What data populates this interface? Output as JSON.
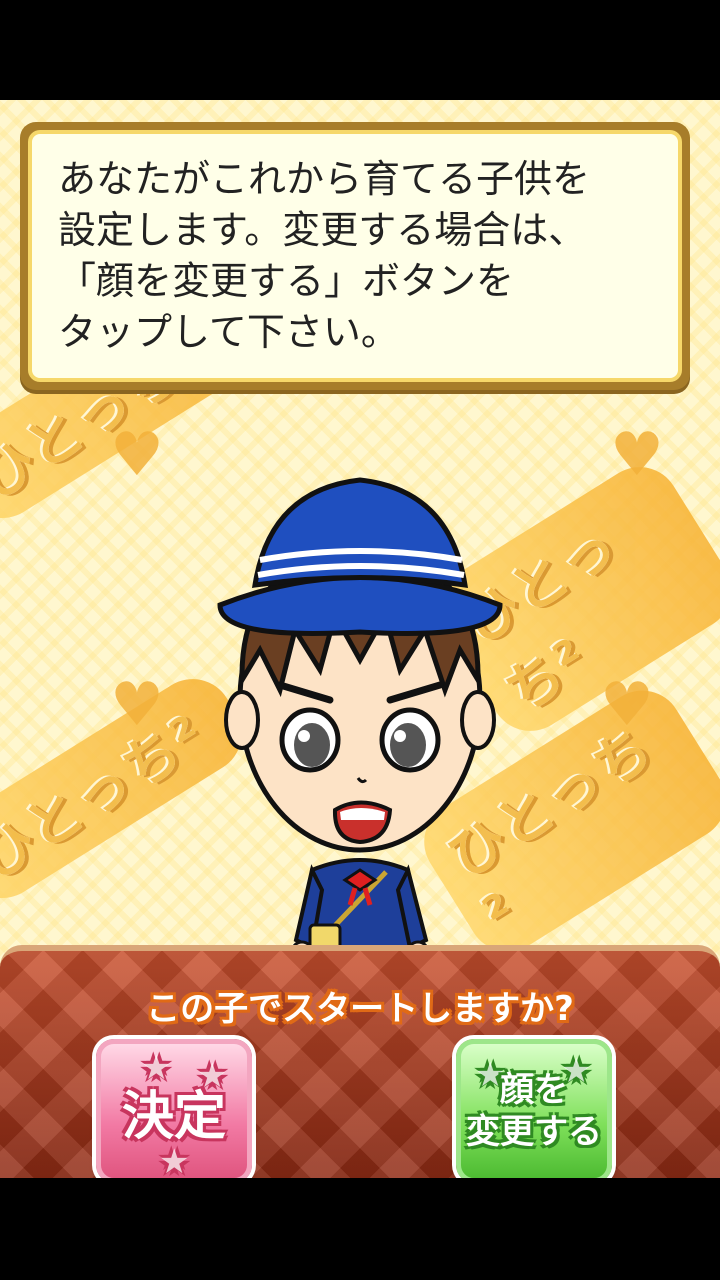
{
  "dialog": {
    "text": "あなたがこれから育てる子供を\n設定します。変更する場合は、\n「顔を変更する」ボタンを\nタップして下さい。"
  },
  "background": {
    "logo_text": "ひとっち²"
  },
  "character": {
    "description_icon": "child-in-school-uniform"
  },
  "panel": {
    "question": "この子でスタートしますか?",
    "ok_button_label": "決定",
    "change_button_line1": "顔を",
    "change_button_line2": "変更する"
  },
  "colors": {
    "panel_red": "#a83a1e",
    "ok_pink": "#f27aa4",
    "change_green": "#6fd64a",
    "dialog_border": "#a77d2a",
    "hat_blue": "#1f4fbf"
  }
}
